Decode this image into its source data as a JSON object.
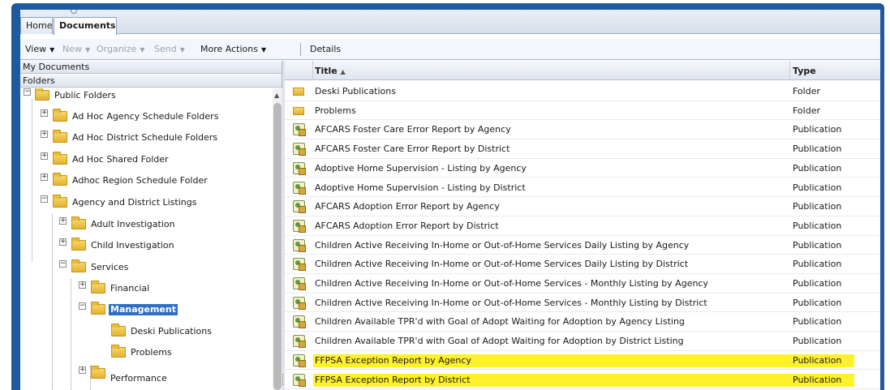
{
  "tabs": [
    {
      "label": "Home"
    },
    {
      "label": "Documents"
    }
  ],
  "toolbar": {
    "view": "View",
    "new": "New",
    "organize": "Organize",
    "send": "Send",
    "more_actions": "More Actions",
    "details": "Details",
    "dropdown_arrow": "▼"
  },
  "left_pane": {
    "my_documents": "My Documents",
    "folders": "Folders",
    "tree": [
      {
        "label": "Public Folders",
        "expander": "−"
      },
      {
        "label": "Ad Hoc Agency Schedule Folders",
        "expander": "+"
      },
      {
        "label": "Ad Hoc District Schedule Folders",
        "expander": "+"
      },
      {
        "label": "Ad Hoc Shared Folder",
        "expander": "+"
      },
      {
        "label": "Adhoc Region Schedule Folder",
        "expander": "+"
      },
      {
        "label": "Agency and District Listings",
        "expander": "−"
      },
      {
        "label": "Adult Investigation",
        "expander": "+"
      },
      {
        "label": "Child Investigation",
        "expander": "+"
      },
      {
        "label": "Services",
        "expander": "−"
      },
      {
        "label": "Financial",
        "expander": "+"
      },
      {
        "label": "Management",
        "expander": "−",
        "selected": true
      },
      {
        "label": "Deski Publications"
      },
      {
        "label": "Problems"
      },
      {
        "label": "Performance",
        "expander": "+"
      }
    ]
  },
  "grid": {
    "col_title": "Title",
    "sort_indicator": "▲",
    "col_type": "Type",
    "rows": [
      {
        "title": "Deski Publications",
        "type": "Folder",
        "icon": "folder-icon"
      },
      {
        "title": "Problems",
        "type": "Folder",
        "icon": "folder-icon"
      },
      {
        "title": "AFCARS Foster Care Error Report by Agency",
        "type": "Publication",
        "icon": "publication-icon"
      },
      {
        "title": "AFCARS Foster Care Error Report by District",
        "type": "Publication",
        "icon": "publication-icon"
      },
      {
        "title": "Adoptive Home Supervision - Listing by Agency",
        "type": "Publication",
        "icon": "publication-icon"
      },
      {
        "title": "Adoptive Home Supervision - Listing by District",
        "type": "Publication",
        "icon": "publication-icon"
      },
      {
        "title": "AFCARS Adoption Error Report by Agency",
        "type": "Publication",
        "icon": "publication-icon"
      },
      {
        "title": "AFCARS Adoption Error Report by District",
        "type": "Publication",
        "icon": "publication-icon"
      },
      {
        "title": "Children Active Receiving In-Home or Out-of-Home Services Daily Listing by Agency",
        "type": "Publication",
        "icon": "publication-icon"
      },
      {
        "title": "Children Active Receiving In-Home or Out-of-Home Services Daily Listing by District",
        "type": "Publication",
        "icon": "publication-icon"
      },
      {
        "title": "Children Active Receiving In-Home or Out-of-Home Services - Monthly Listing by Agency",
        "type": "Publication",
        "icon": "publication-icon"
      },
      {
        "title": "Children Active Receiving In-Home or Out-of-Home Services - Monthly Listing by District",
        "type": "Publication",
        "icon": "publication-icon"
      },
      {
        "title": "Children Available TPR'd with Goal of Adopt Waiting for Adoption by Agency Listing",
        "type": "Publication",
        "icon": "publication-icon"
      },
      {
        "title": "Children Available TPR'd with Goal of Adopt Waiting for Adoption by District Listing",
        "type": "Publication",
        "icon": "publication-icon"
      },
      {
        "title": "FFPSA Exception Report by Agency",
        "type": "Publication",
        "icon": "publication-icon",
        "highlighted": true
      },
      {
        "title": "FFPSA Exception Report by District",
        "type": "Publication",
        "icon": "publication-icon",
        "highlighted": true
      }
    ]
  },
  "colors": {
    "frame": "#1f5a9e",
    "selection": "#2f6fc3",
    "highlight": "#fff22a"
  }
}
